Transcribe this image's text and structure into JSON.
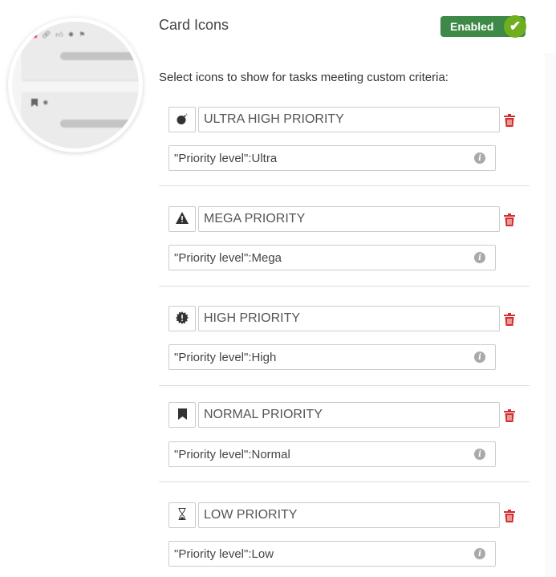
{
  "preview": {
    "card1_icons": [
      "link-icon",
      "thumbs-up-icon",
      "bug-icon",
      "flag-icon"
    ],
    "card2_icons": [
      "bookmark-icon",
      "bug-icon"
    ]
  },
  "header": {
    "title": "Card Icons",
    "toggle_label": "Enabled",
    "toggle_state": true,
    "toggle_color": "#3e8948",
    "check_color": "#6fae1f"
  },
  "subtitle": "Select icons to show for tasks meeting custom criteria:",
  "rules": [
    {
      "icon": "bomb-icon",
      "name": "ULTRA HIGH PRIORITY",
      "criteria": "\"Priority level\":Ultra"
    },
    {
      "icon": "warning-icon",
      "name": "MEGA PRIORITY",
      "criteria": "\"Priority level\":Mega"
    },
    {
      "icon": "certificate-icon",
      "name": "HIGH PRIORITY",
      "criteria": "\"Priority level\":High"
    },
    {
      "icon": "bookmark-icon",
      "name": "NORMAL PRIORITY",
      "criteria": "\"Priority level\":Normal"
    },
    {
      "icon": "hourglass-icon",
      "name": "LOW PRIORITY",
      "criteria": "\"Priority level\":Low"
    }
  ],
  "colors": {
    "delete": "#d32f2f",
    "info": "#a9a9a9"
  }
}
